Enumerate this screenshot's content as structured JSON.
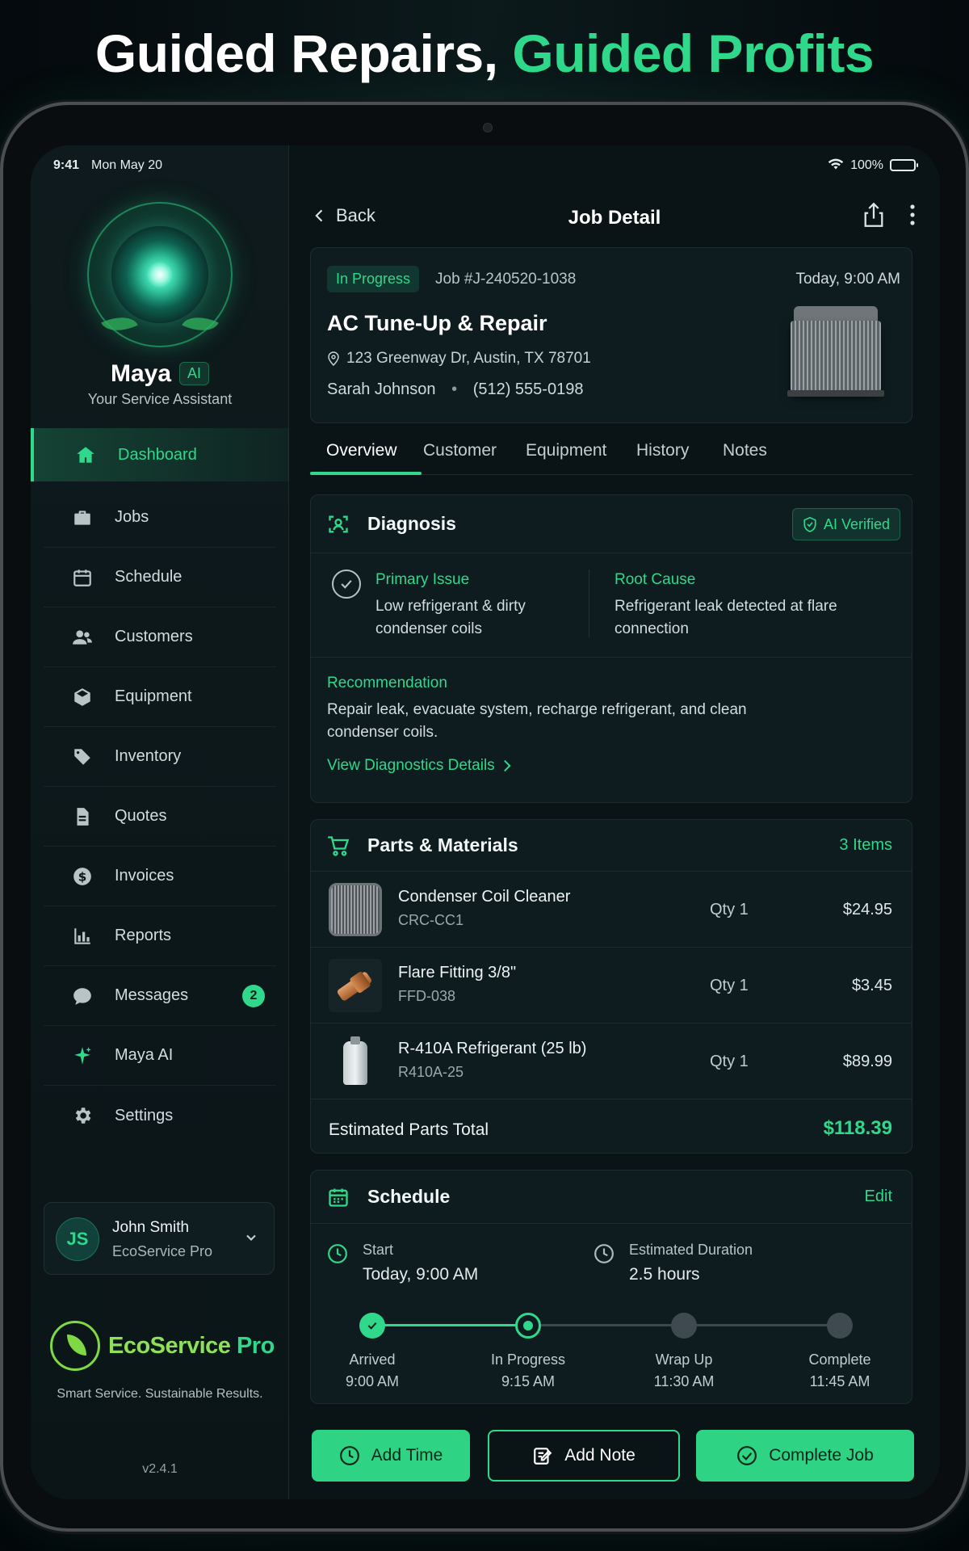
{
  "headline": {
    "part1": "Guided Repairs,",
    "part2": "Guided Profits"
  },
  "status_bar": {
    "time": "9:41",
    "date": "Mon May 20",
    "battery": "100%"
  },
  "sidebar": {
    "assistant_name": "Maya",
    "assistant_badge": "AI",
    "assistant_subtitle": "Your Service Assistant",
    "items": [
      {
        "label": "Dashboard",
        "icon": "home-icon",
        "active": true
      },
      {
        "label": "Jobs",
        "icon": "briefcase-icon"
      },
      {
        "label": "Schedule",
        "icon": "calendar-icon"
      },
      {
        "label": "Customers",
        "icon": "users-icon"
      },
      {
        "label": "Equipment",
        "icon": "box-icon"
      },
      {
        "label": "Inventory",
        "icon": "tag-icon"
      },
      {
        "label": "Quotes",
        "icon": "document-icon"
      },
      {
        "label": "Invoices",
        "icon": "dollar-icon"
      },
      {
        "label": "Reports",
        "icon": "bar-chart-icon"
      },
      {
        "label": "Messages",
        "icon": "chat-icon",
        "badge": "2"
      },
      {
        "label": "Maya AI",
        "icon": "sparkle-icon"
      },
      {
        "label": "Settings",
        "icon": "gear-icon"
      }
    ],
    "user": {
      "initials": "JS",
      "name": "John Smith",
      "role": "EcoService Pro"
    },
    "brand": {
      "name_part1": "EcoService",
      "name_part2": " Pro",
      "tagline": "Smart Service. Sustainable Results."
    },
    "version": "v2.4.1"
  },
  "header": {
    "back_label": "Back",
    "title": "Job Detail"
  },
  "job": {
    "status": "In Progress",
    "number": "Job #J-240520-1038",
    "time": "Today, 9:00 AM",
    "title": "AC Tune-Up & Repair",
    "address": "123 Greenway Dr, Austin, TX 78701",
    "customer": "Sarah Johnson",
    "separator": "•",
    "phone": "(512) 555-0198"
  },
  "tabs": [
    "Overview",
    "Customer",
    "Equipment",
    "History",
    "Notes"
  ],
  "diagnosis": {
    "title": "Diagnosis",
    "badge": "AI Verified",
    "primary_label": "Primary Issue",
    "primary_text": "Low refrigerant & dirty condenser coils",
    "root_label": "Root Cause",
    "root_text": "Refrigerant leak detected at flare connection",
    "rec_label": "Recommendation",
    "rec_text": "Repair leak, evacuate system, recharge refrigerant, and clean condenser coils.",
    "link": "View Diagnostics Details"
  },
  "parts": {
    "title": "Parts & Materials",
    "count": "3 Items",
    "rows": [
      {
        "name": "Condenser Coil Cleaner",
        "sku": "CRC-CC1",
        "qty": "Qty 1",
        "price": "$24.95"
      },
      {
        "name": "Flare Fitting 3/8\"",
        "sku": "FFD-038",
        "qty": "Qty 1",
        "price": "$3.45"
      },
      {
        "name": "R-410A Refrigerant (25 lb)",
        "sku": "R410A-25",
        "qty": "Qty 1",
        "price": "$89.99"
      }
    ],
    "total_label": "Estimated Parts Total",
    "total_value": "$118.39"
  },
  "schedule": {
    "title": "Schedule",
    "edit": "Edit",
    "start_label": "Start",
    "start_value": "Today, 9:00 AM",
    "duration_label": "Estimated Duration",
    "duration_value": "2.5 hours",
    "steps": [
      {
        "name": "Arrived",
        "time": "9:00 AM",
        "state": "done"
      },
      {
        "name": "In Progress",
        "time": "9:15 AM",
        "state": "current"
      },
      {
        "name": "Wrap Up",
        "time": "11:30 AM",
        "state": "pending"
      },
      {
        "name": "Complete",
        "time": "11:45 AM",
        "state": "pending"
      }
    ]
  },
  "actions": {
    "add_time": "Add Time",
    "add_note": "Add Note",
    "complete": "Complete Job"
  },
  "colors": {
    "accent": "#2fd88a",
    "background": "#0a1417",
    "card": "#0e1c20"
  }
}
